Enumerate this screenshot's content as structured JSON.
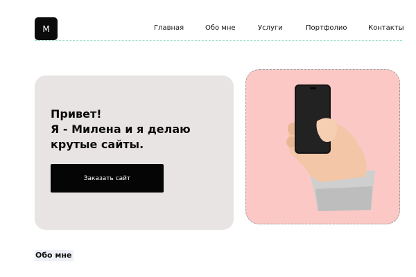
{
  "header": {
    "logo_letter": "M",
    "nav": [
      {
        "label": "Главная"
      },
      {
        "label": "Обо мне"
      },
      {
        "label": "Услуги"
      },
      {
        "label": "Портфолио"
      },
      {
        "label": "Контакты"
      }
    ]
  },
  "hero": {
    "title_lines": [
      "Привет!",
      "Я - Милена и я делаю",
      "крутые сайты."
    ],
    "button_label": "Заказать сайт",
    "image_alt_icon": "hand-holding-phone-icon"
  },
  "sections": {
    "about_title": "Обо мне"
  },
  "colors": {
    "hero_card_bg": "#e8e4e3",
    "image_card_bg": "#fcc8c5",
    "button_bg": "#050505",
    "accent_line": "#9ee0d2"
  }
}
